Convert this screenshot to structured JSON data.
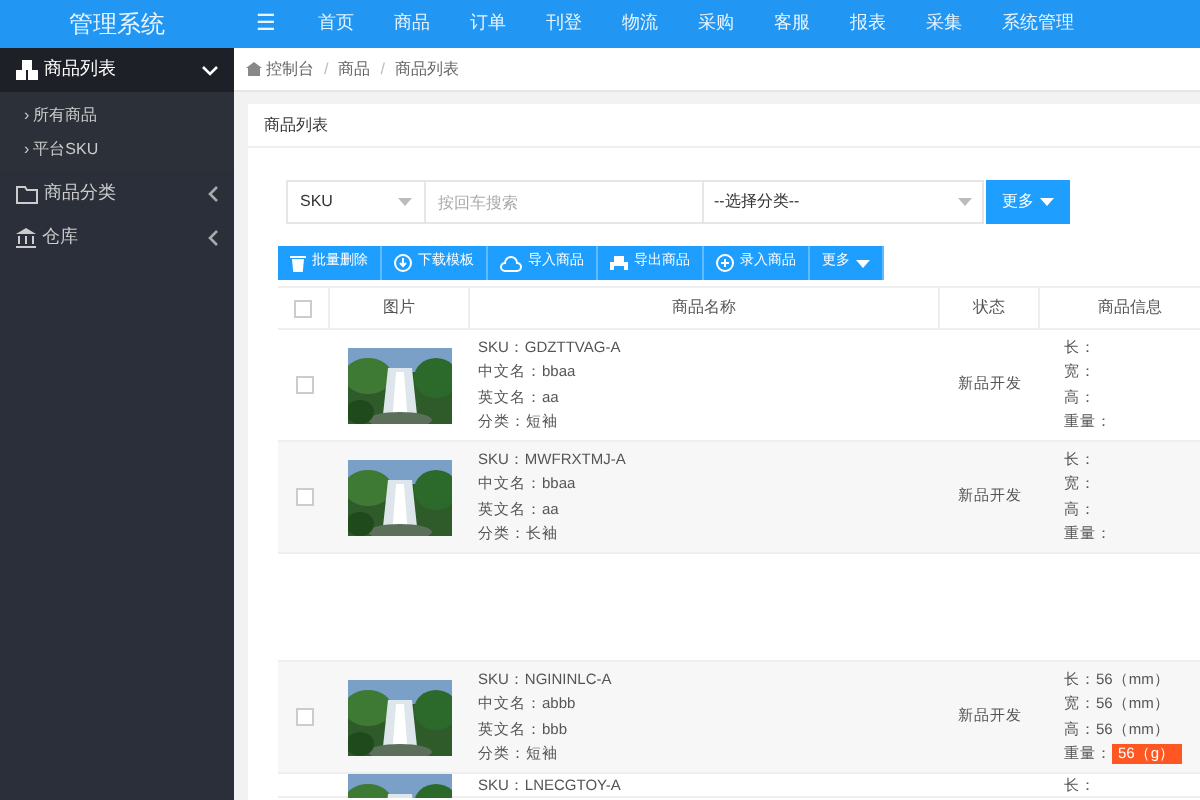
{
  "header": {
    "logo": "管理系统",
    "menu_icon": "☰",
    "nav": [
      {
        "label": "首页"
      },
      {
        "label": "商品"
      },
      {
        "label": "订单"
      },
      {
        "label": "刊登"
      },
      {
        "label": "物流"
      },
      {
        "label": "采购"
      },
      {
        "label": "客服"
      },
      {
        "label": "报表"
      },
      {
        "label": "采集"
      },
      {
        "label": "系统管理"
      }
    ]
  },
  "sidebar": {
    "items": [
      {
        "label": "商品列表",
        "expanded": true,
        "children": [
          {
            "bullet": "›",
            "label": "所有商品"
          },
          {
            "bullet": "›",
            "label": "平台SKU"
          }
        ]
      },
      {
        "label": "商品分类",
        "expanded": false
      },
      {
        "label": "仓库",
        "expanded": false
      }
    ]
  },
  "breadcrumb": {
    "separator": "/",
    "items": [
      "控制台",
      "商品",
      "商品列表"
    ]
  },
  "card_title": "商品列表",
  "search": {
    "type_select": "SKU",
    "keyword": {
      "placeholder": "按回车搜索"
    },
    "category_select": "--选择分类--",
    "more_button": "更多"
  },
  "toolbar": [
    {
      "label": "批量删除"
    },
    {
      "label": "下载模板"
    },
    {
      "label": "导入商品"
    },
    {
      "label": "导出商品"
    },
    {
      "label": "录入商品"
    },
    {
      "label": "更多",
      "kind": "dropdown"
    }
  ],
  "table": {
    "columns": [
      "图片",
      "商品名称",
      "状态",
      "商品信息"
    ],
    "header_checked": false,
    "rows": [
      {
        "kind": "product",
        "checked": false,
        "name_lines": [
          "SKU：GDZTTVAG-A",
          "中文名：bbaa",
          "英文名：aa",
          "分类：短袖"
        ],
        "status": "新品开发",
        "info": [
          {
            "text": "长："
          },
          {
            "text": "宽："
          },
          {
            "text": "高："
          },
          {
            "text": "重量："
          }
        ]
      },
      {
        "kind": "product",
        "checked": false,
        "name_lines": [
          "SKU：MWFRXTMJ-A",
          "中文名：bbaa",
          "英文名：aa",
          "分类：长袖"
        ],
        "status": "新品开发",
        "info": [
          {
            "text": "长："
          },
          {
            "text": "宽："
          },
          {
            "text": "高："
          },
          {
            "text": "重量："
          }
        ]
      },
      {
        "kind": "covered"
      },
      {
        "kind": "product",
        "checked": false,
        "name_lines": [
          "SKU：NGININLC-A",
          "中文名：abbb",
          "英文名：bbb",
          "分类：短袖"
        ],
        "status": "新品开发",
        "info": [
          {
            "text": "长：56（mm）"
          },
          {
            "text": "宽：56（mm）"
          },
          {
            "text": "高：56（mm）"
          },
          {
            "text": "重量：",
            "badge": "56（g）"
          }
        ]
      },
      {
        "kind": "partial",
        "name_lines": [
          "SKU：LNECGTOY-A"
        ],
        "info": [
          {
            "text": "长："
          }
        ]
      }
    ]
  }
}
